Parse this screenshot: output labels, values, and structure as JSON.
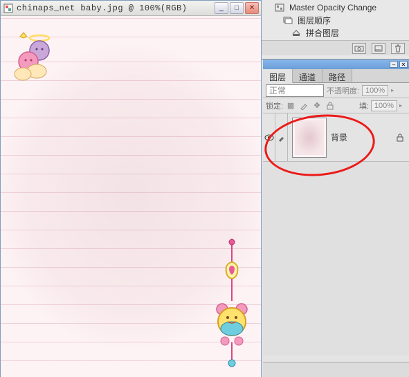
{
  "document": {
    "title": "chinaps_net baby.jpg @ 100%(RGB)"
  },
  "history": {
    "items": [
      {
        "label": "Master Opacity Change"
      },
      {
        "label": "图层顺序"
      },
      {
        "label": "拼合图层"
      }
    ]
  },
  "layers_panel": {
    "tabs": [
      "图层",
      "通道",
      "路径"
    ],
    "active_tab": 0,
    "blend_mode": "正常",
    "opacity_label": "不透明度:",
    "opacity_value": "100%",
    "lock_label": "锁定:",
    "fill_label": "填:",
    "fill_value": "100%",
    "layers": [
      {
        "name": "背景",
        "visible": true,
        "locked": true
      }
    ]
  }
}
